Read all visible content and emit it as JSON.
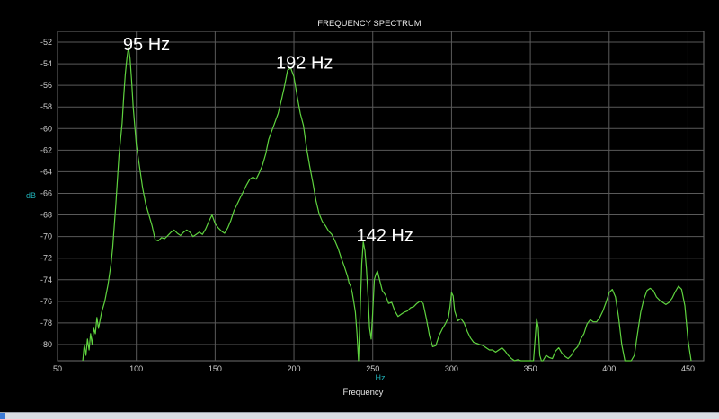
{
  "chart_data": {
    "type": "line",
    "title": "FREQUENCY SPECTRUM",
    "xlabel": "Frequency",
    "xunit": "Hz",
    "ylabel": "dB",
    "xlim": [
      50,
      460
    ],
    "ylim": [
      -81.5,
      -51
    ],
    "xticks": [
      50,
      100,
      150,
      200,
      250,
      300,
      350,
      400,
      450
    ],
    "yticks": [
      -52,
      -54,
      -56,
      -58,
      -60,
      -62,
      -64,
      -66,
      -68,
      -70,
      -72,
      -74,
      -76,
      -78,
      -80
    ],
    "grid": true,
    "line_color": "#5fd33f",
    "annotations": [
      {
        "text": "95 Hz",
        "x": 95,
        "y": -52.5
      },
      {
        "text": "192 Hz",
        "x": 192,
        "y": -54.2
      },
      {
        "text": "142 Hz",
        "x": 243,
        "y": -70.2
      }
    ],
    "series": [
      {
        "name": "",
        "x": [
          66,
          67,
          68,
          69,
          70,
          71,
          72,
          73,
          74,
          75,
          76,
          78,
          80,
          82,
          84,
          85,
          87,
          89,
          91,
          92,
          93,
          94,
          95,
          96,
          97,
          98,
          100,
          102,
          104,
          106,
          108,
          110,
          112,
          114,
          116,
          118,
          120,
          122,
          124,
          126,
          128,
          130,
          132,
          134,
          136,
          138,
          140,
          142,
          144,
          146,
          148,
          150,
          152,
          154,
          156,
          158,
          160,
          162,
          164,
          166,
          168,
          170,
          172,
          174,
          176,
          178,
          180,
          182,
          184,
          186,
          188,
          190,
          192,
          194,
          196,
          198,
          200,
          202,
          204,
          206,
          208,
          210,
          212,
          214,
          216,
          218,
          220,
          222,
          224,
          226,
          228,
          230,
          232,
          234,
          235,
          236,
          237,
          238,
          239,
          240,
          241,
          242,
          243,
          244,
          245,
          246,
          247,
          248,
          249,
          250,
          251,
          252,
          253,
          254,
          256,
          258,
          260,
          262,
          264,
          266,
          268,
          270,
          272,
          274,
          276,
          278,
          280,
          282,
          284,
          286,
          288,
          290,
          292,
          294,
          296,
          298,
          299,
          300,
          301,
          302,
          304,
          306,
          308,
          310,
          312,
          314,
          316,
          318,
          320,
          322,
          324,
          326,
          328,
          330,
          332,
          334,
          336,
          338,
          340,
          342,
          344,
          346,
          348,
          350,
          352,
          353,
          354,
          355,
          356,
          357,
          358,
          360,
          362,
          364,
          366,
          368,
          370,
          372,
          374,
          376,
          378,
          380,
          382,
          384,
          386,
          388,
          390,
          392,
          394,
          396,
          398,
          400,
          402,
          404,
          406,
          408,
          410,
          412,
          414,
          416,
          418,
          420,
          422,
          424,
          426,
          428,
          430,
          432,
          434,
          436,
          438,
          440,
          442,
          444,
          446,
          448,
          450,
          452
        ],
        "y": [
          -81.5,
          -80,
          -81,
          -79.5,
          -80.5,
          -79,
          -80,
          -78.5,
          -79,
          -77.5,
          -78.5,
          -77,
          -76,
          -74.5,
          -72.5,
          -71,
          -67,
          -62.5,
          -59.5,
          -57,
          -55,
          -53.5,
          -52.5,
          -53.5,
          -55.5,
          -58,
          -61.5,
          -63.5,
          -65.5,
          -67,
          -68,
          -69,
          -70.3,
          -70.4,
          -70.1,
          -70.2,
          -69.9,
          -69.6,
          -69.4,
          -69.7,
          -69.9,
          -69.6,
          -69.4,
          -69.6,
          -70,
          -69.8,
          -69.6,
          -69.8,
          -69.3,
          -68.6,
          -68,
          -68.8,
          -69.2,
          -69.5,
          -69.7,
          -69.2,
          -68.5,
          -67.6,
          -67,
          -66.4,
          -65.8,
          -65.2,
          -64.7,
          -64.5,
          -64.7,
          -64.1,
          -63.4,
          -62.4,
          -61,
          -60.2,
          -59.4,
          -58.6,
          -57.4,
          -56.1,
          -54.6,
          -54.4,
          -55.2,
          -57,
          -58.6,
          -59.7,
          -61.8,
          -63.5,
          -65,
          -66.7,
          -67.9,
          -68.6,
          -69,
          -69.5,
          -69.8,
          -70.4,
          -71.1,
          -72,
          -72.8,
          -73.7,
          -74.3,
          -74.6,
          -75.2,
          -76.1,
          -77,
          -79,
          -81.5,
          -77,
          -72.5,
          -70.5,
          -71.3,
          -73,
          -75.5,
          -78.5,
          -79.5,
          -77,
          -74,
          -73.5,
          -73.2,
          -73.8,
          -75,
          -75.4,
          -76.2,
          -76.1,
          -76.9,
          -77.4,
          -77.2,
          -77,
          -76.9,
          -76.6,
          -76.5,
          -76.2,
          -76,
          -76.2,
          -77.6,
          -79.2,
          -80.2,
          -80.1,
          -79.2,
          -78.6,
          -78.1,
          -77.5,
          -76.5,
          -75.2,
          -75.5,
          -76.9,
          -77.8,
          -77.6,
          -78,
          -78.8,
          -79.4,
          -79.8,
          -79.9,
          -80,
          -80.1,
          -80.3,
          -80.5,
          -80.5,
          -80.7,
          -80.5,
          -80.3,
          -80.6,
          -81,
          -81.3,
          -81.5,
          -81.4,
          -81.5,
          -81.5,
          -81.5,
          -81.5,
          -81.5,
          -79.5,
          -77.6,
          -78.4,
          -81,
          -81.5,
          -81.5,
          -81,
          -81.2,
          -81.3,
          -80.6,
          -80.3,
          -80.8,
          -81.1,
          -81.3,
          -81,
          -80.5,
          -80.2,
          -79.5,
          -79,
          -78.1,
          -77.7,
          -77.9,
          -77.9,
          -77.5,
          -76.9,
          -76.1,
          -75.2,
          -74.9,
          -75.6,
          -77.5,
          -80,
          -81.5,
          -81.5,
          -81.5,
          -81,
          -79,
          -77,
          -75.8,
          -75,
          -74.8,
          -75,
          -75.6,
          -75.9,
          -76.1,
          -76.3,
          -76.1,
          -75.7,
          -75.1,
          -74.6,
          -74.9,
          -76.4,
          -79.6,
          -81.5
        ]
      }
    ]
  }
}
